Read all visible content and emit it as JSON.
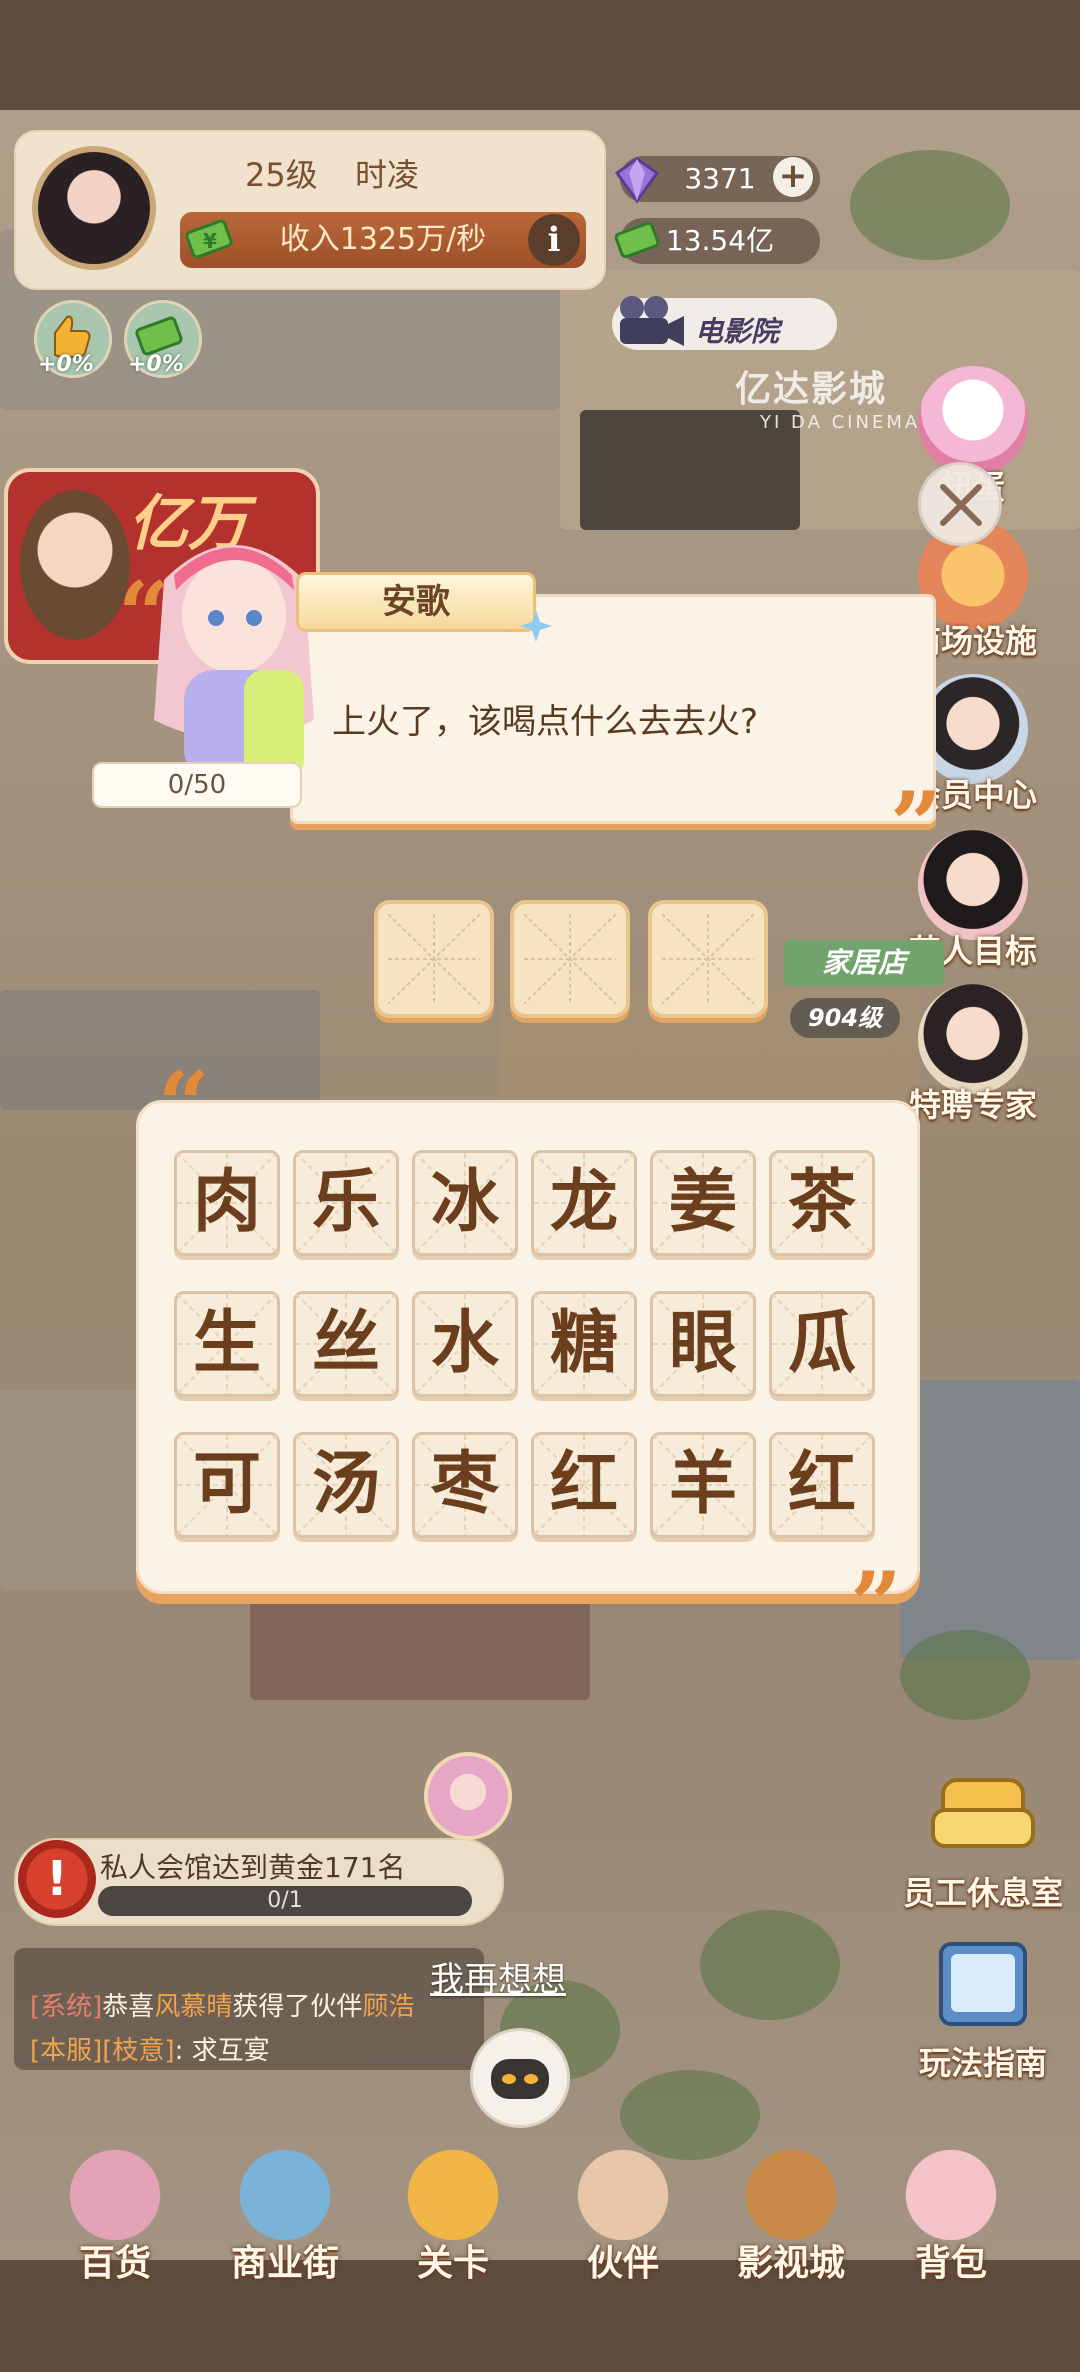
{
  "player": {
    "level": "25级",
    "name": "时凌",
    "income": "收入1325万/秒"
  },
  "resources": {
    "gems": "3371",
    "cash": "13.54亿"
  },
  "boosts": {
    "like_pct": "+0%",
    "cash_pct": "+0%"
  },
  "location": {
    "cinema_tag": "电影院",
    "cinema_sign": "亿达影城",
    "cinema_sub": "YI DA CINEMA",
    "event_text": "亿万",
    "shop_tag": "家居店",
    "shop_level": "904级"
  },
  "side_menu": [
    {
      "label": "扭蛋",
      "icon": "gashapon-icon"
    },
    {
      "label": "商场设施",
      "icon": "mall-facility-icon"
    },
    {
      "label": "会员中心",
      "icon": "member-center-icon"
    },
    {
      "label": "艺人目标",
      "icon": "artist-goal-icon"
    },
    {
      "label": "特聘专家",
      "icon": "expert-icon"
    }
  ],
  "dialog": {
    "speaker": "安歌",
    "question": "上火了，该喝点什么去去火?",
    "progress": "0/50",
    "answer_slots": 3
  },
  "characters": [
    [
      "肉",
      "乐",
      "冰",
      "龙",
      "姜",
      "茶"
    ],
    [
      "生",
      "丝",
      "水",
      "糖",
      "眼",
      "瓜"
    ],
    [
      "可",
      "汤",
      "枣",
      "红",
      "羊",
      "红"
    ]
  ],
  "task": {
    "text": "私人会馆达到黄金171名",
    "count": "0/1"
  },
  "rethink": "我再想想",
  "chat": {
    "line1_tag": "[系统]",
    "line1_a": "恭喜",
    "line1_name": "风慕晴",
    "line1_b": "获得了伙伴",
    "line1_partner": "顾浩",
    "line2_tag1": "[本服]",
    "line2_tag2": "[枝意]",
    "line2_text": ": 求互宴"
  },
  "right_buttons": {
    "staff_room": "员工休息室",
    "guide": "玩法指南"
  },
  "bottom_nav": [
    {
      "label": "百货",
      "icon": "department-store-icon"
    },
    {
      "label": "商业街",
      "icon": "commercial-street-icon"
    },
    {
      "label": "关卡",
      "icon": "level-truck-icon"
    },
    {
      "label": "伙伴",
      "icon": "partner-icon"
    },
    {
      "label": "影视城",
      "icon": "film-city-icon"
    },
    {
      "label": "背包",
      "icon": "backpack-icon"
    }
  ],
  "colors": {
    "accent_orange": "#e8a45f",
    "panel_cream": "#fbf3e6",
    "char_brown": "#6b3f1e"
  }
}
